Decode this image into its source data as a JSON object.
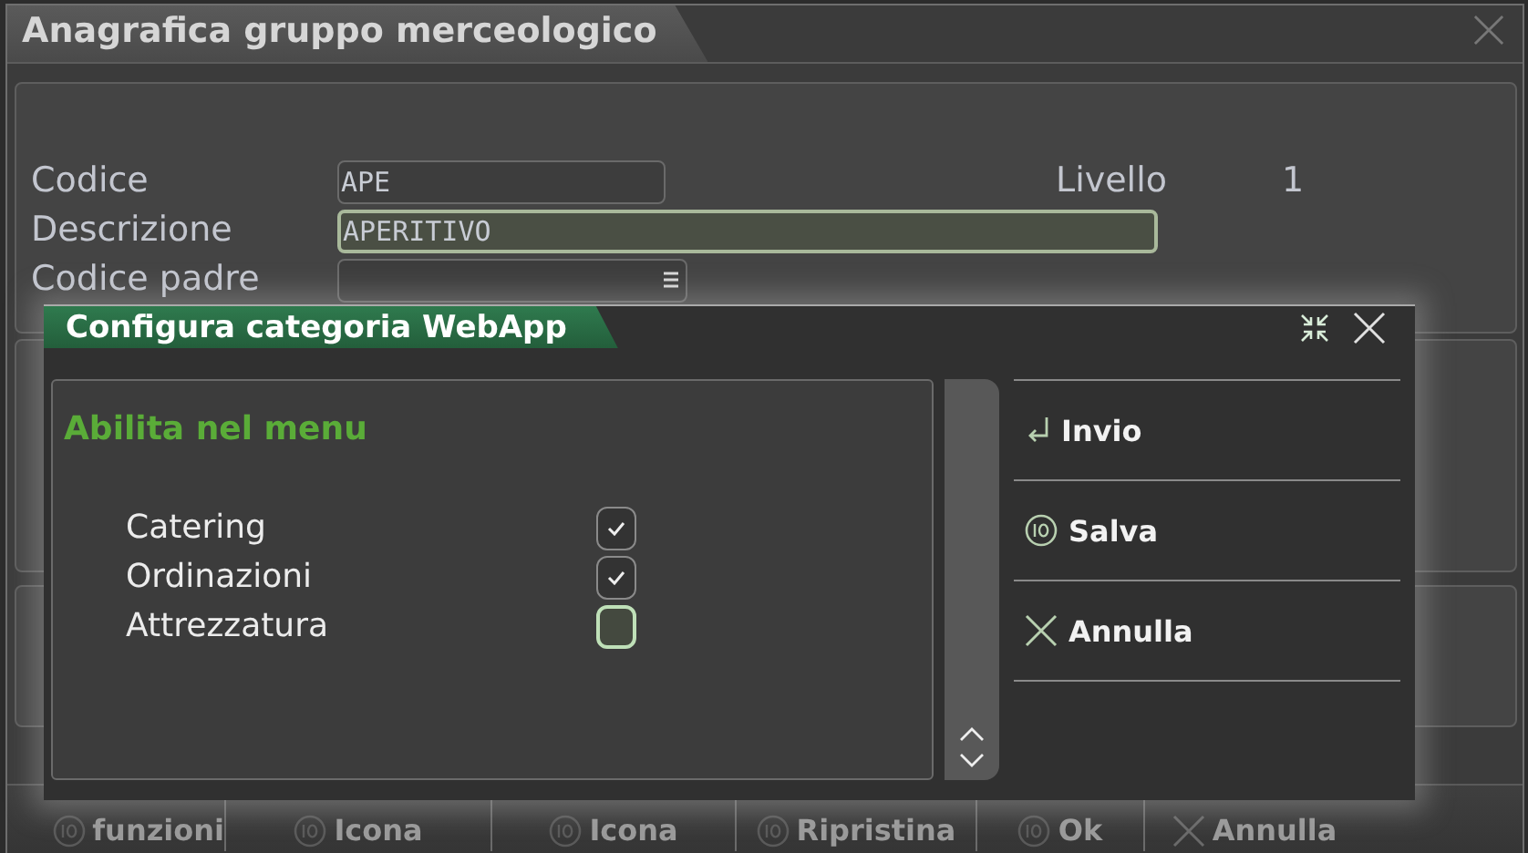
{
  "window": {
    "title": "Anagrafica gruppo merceologico"
  },
  "fields": [
    {
      "label": "Codice",
      "value": "APE",
      "kind": "text",
      "focused": false
    },
    {
      "label": "Descrizione",
      "value": "APERITIVO",
      "kind": "text",
      "focused": true
    },
    {
      "label": "Codice padre",
      "kind": "lookup",
      "focused": false
    }
  ],
  "level": {
    "label": "Livello",
    "value": "1"
  },
  "toolbar": [
    {
      "label": "funzioni",
      "kind": "number"
    },
    {
      "label": "Icona",
      "kind": "number"
    },
    {
      "label": "Icona",
      "kind": "number"
    },
    {
      "label": "Ripristina",
      "kind": "number"
    },
    {
      "label": "Ok",
      "kind": "number"
    },
    {
      "label": "Annulla",
      "kind": "cancel"
    }
  ],
  "dialog": {
    "title": "Configura categoria WebApp",
    "section_title": "Abilita nel menu",
    "options": [
      {
        "label": "Catering",
        "checked": true
      },
      {
        "label": "Ordinazioni",
        "checked": true
      },
      {
        "label": "Attrezzatura",
        "checked": false
      }
    ],
    "actions": [
      {
        "label": "Invio",
        "kind": "enter"
      },
      {
        "label": "Salva",
        "kind": "save"
      },
      {
        "label": "Annulla",
        "kind": "cancel"
      }
    ]
  }
}
